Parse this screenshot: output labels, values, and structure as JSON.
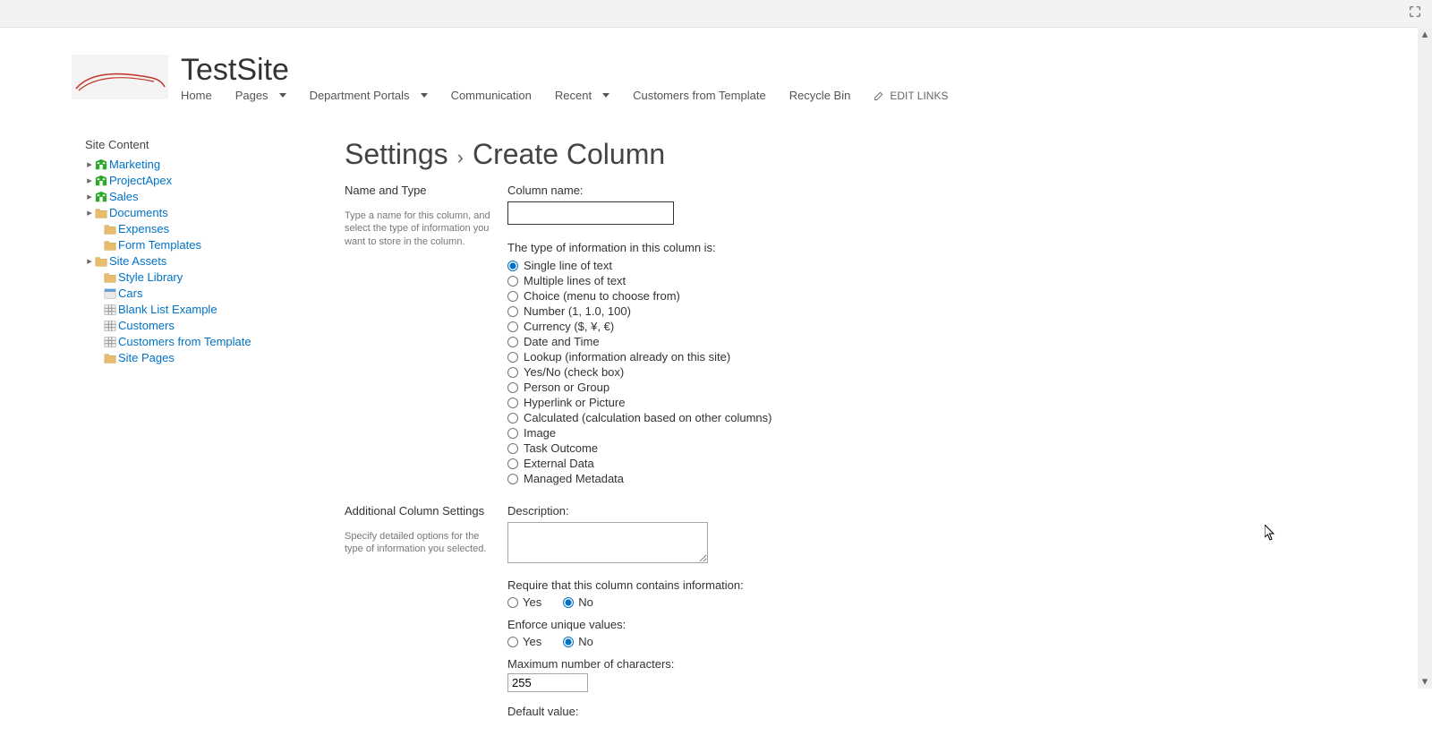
{
  "site": {
    "title": "TestSite"
  },
  "topNav": {
    "items": [
      {
        "label": "Home",
        "has_dropdown": false
      },
      {
        "label": "Pages",
        "has_dropdown": true
      },
      {
        "label": "Department Portals",
        "has_dropdown": true
      },
      {
        "label": "Communication",
        "has_dropdown": false
      },
      {
        "label": "Recent",
        "has_dropdown": true
      },
      {
        "label": "Customers from Template",
        "has_dropdown": false
      },
      {
        "label": "Recycle Bin",
        "has_dropdown": false
      }
    ],
    "editLinksLabel": "EDIT LINKS"
  },
  "leftNav": {
    "heading": "Site Content",
    "items": [
      {
        "label": "Marketing",
        "kind": "subsite",
        "expandable": true,
        "indent": false
      },
      {
        "label": "ProjectApex",
        "kind": "subsite",
        "expandable": true,
        "indent": false
      },
      {
        "label": "Sales",
        "kind": "subsite",
        "expandable": true,
        "indent": false
      },
      {
        "label": "Documents",
        "kind": "library",
        "expandable": true,
        "indent": false
      },
      {
        "label": "Expenses",
        "kind": "library",
        "expandable": false,
        "indent": true
      },
      {
        "label": "Form Templates",
        "kind": "library",
        "expandable": false,
        "indent": true
      },
      {
        "label": "Site Assets",
        "kind": "library",
        "expandable": true,
        "indent": false
      },
      {
        "label": "Style Library",
        "kind": "library",
        "expandable": false,
        "indent": true
      },
      {
        "label": "Cars",
        "kind": "list",
        "expandable": false,
        "indent": true
      },
      {
        "label": "Blank List Example",
        "kind": "table",
        "expandable": false,
        "indent": true
      },
      {
        "label": "Customers",
        "kind": "table",
        "expandable": false,
        "indent": true
      },
      {
        "label": "Customers from Template",
        "kind": "table",
        "expandable": false,
        "indent": true
      },
      {
        "label": "Site Pages",
        "kind": "library",
        "expandable": false,
        "indent": true
      }
    ]
  },
  "breadcrumb": {
    "root": "Settings",
    "current": "Create Column"
  },
  "nameType": {
    "sectionTitle": "Name and Type",
    "help": "Type a name for this column, and select the type of information you want to store in the column.",
    "columnNameLabel": "Column name:",
    "columnNameValue": "",
    "typeHeading": "The type of information in this column is:",
    "typeOptions": [
      "Single line of text",
      "Multiple lines of text",
      "Choice (menu to choose from)",
      "Number (1, 1.0, 100)",
      "Currency ($, ¥, €)",
      "Date and Time",
      "Lookup (information already on this site)",
      "Yes/No (check box)",
      "Person or Group",
      "Hyperlink or Picture",
      "Calculated (calculation based on other columns)",
      "Image",
      "Task Outcome",
      "External Data",
      "Managed Metadata"
    ],
    "typeSelectedIndex": 0
  },
  "addl": {
    "sectionTitle": "Additional Column Settings",
    "help": "Specify detailed options for the type of information you selected.",
    "descriptionLabel": "Description:",
    "descriptionValue": "",
    "requireLabel": "Require that this column contains information:",
    "yes": "Yes",
    "no": "No",
    "requireValue": "No",
    "uniqueLabel": "Enforce unique values:",
    "uniqueValue": "No",
    "maxCharsLabel": "Maximum number of characters:",
    "maxCharsValue": "255",
    "defaultValueLabel": "Default value:"
  }
}
